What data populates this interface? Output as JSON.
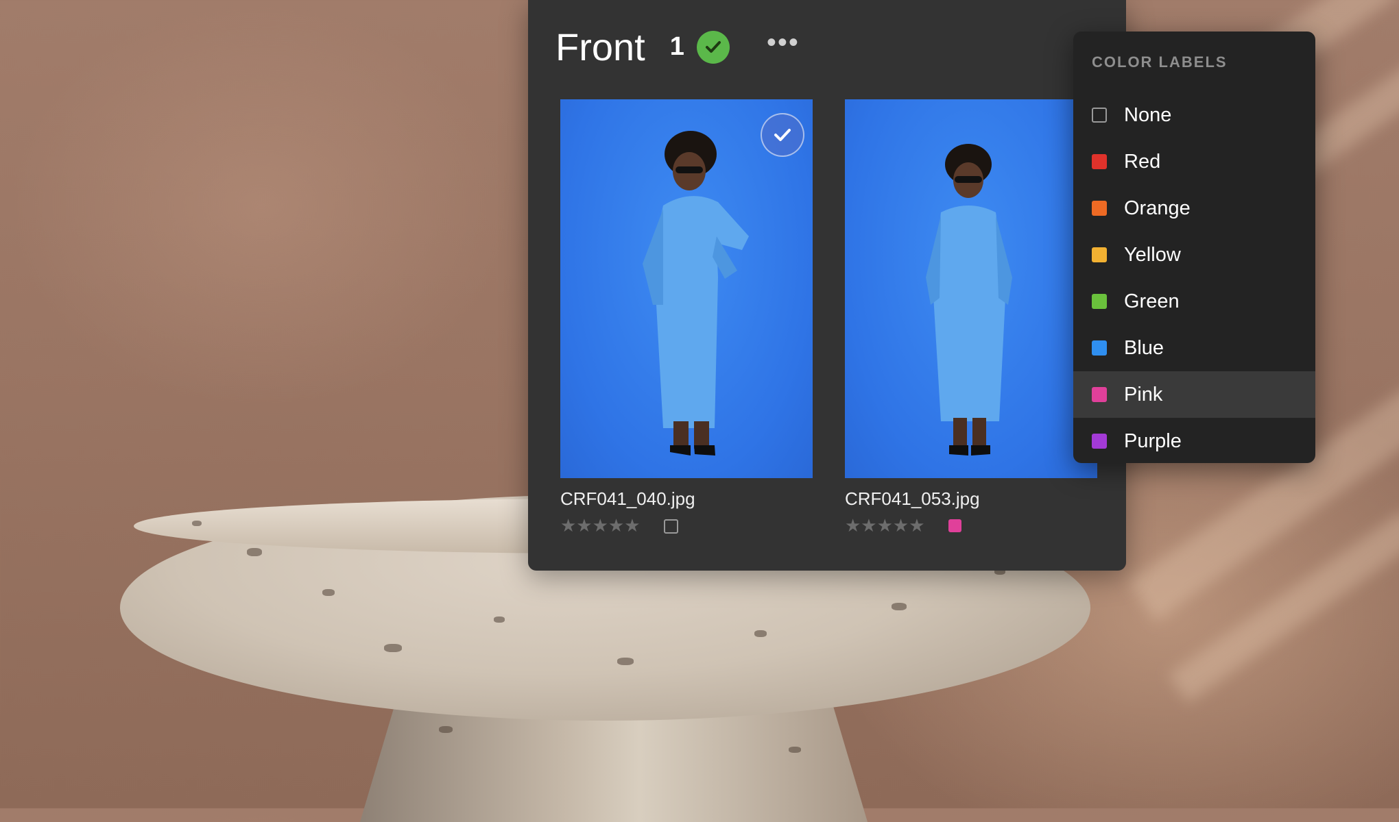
{
  "panel": {
    "title": "Front",
    "count": "1",
    "more_icon": "more-horizontal-icon",
    "approved_icon": "check-circle-icon"
  },
  "thumbnails": [
    {
      "filename": "CRF041_040.jpg",
      "stars": "★★★★★",
      "rating": 0,
      "selected": true,
      "color_label": "none"
    },
    {
      "filename": "CRF041_053.jpg",
      "stars": "★★★★★",
      "rating": 0,
      "selected": false,
      "color_label": "#e0409a"
    }
  ],
  "color_menu": {
    "title": "COLOR LABELS",
    "items": [
      {
        "label": "None",
        "color": "none"
      },
      {
        "label": "Red",
        "color": "#e0322b"
      },
      {
        "label": "Orange",
        "color": "#ee6a24"
      },
      {
        "label": "Yellow",
        "color": "#f2b132"
      },
      {
        "label": "Green",
        "color": "#6ac13c"
      },
      {
        "label": "Blue",
        "color": "#2f8ff0"
      },
      {
        "label": "Pink",
        "color": "#e0409a"
      },
      {
        "label": "Purple",
        "color": "#a33ad6"
      }
    ],
    "highlighted": "Pink"
  },
  "colors": {
    "panel_bg": "#333333",
    "menu_bg": "#232323",
    "approved_green": "#5bb84a",
    "photo_blue": "#2f74e6"
  }
}
